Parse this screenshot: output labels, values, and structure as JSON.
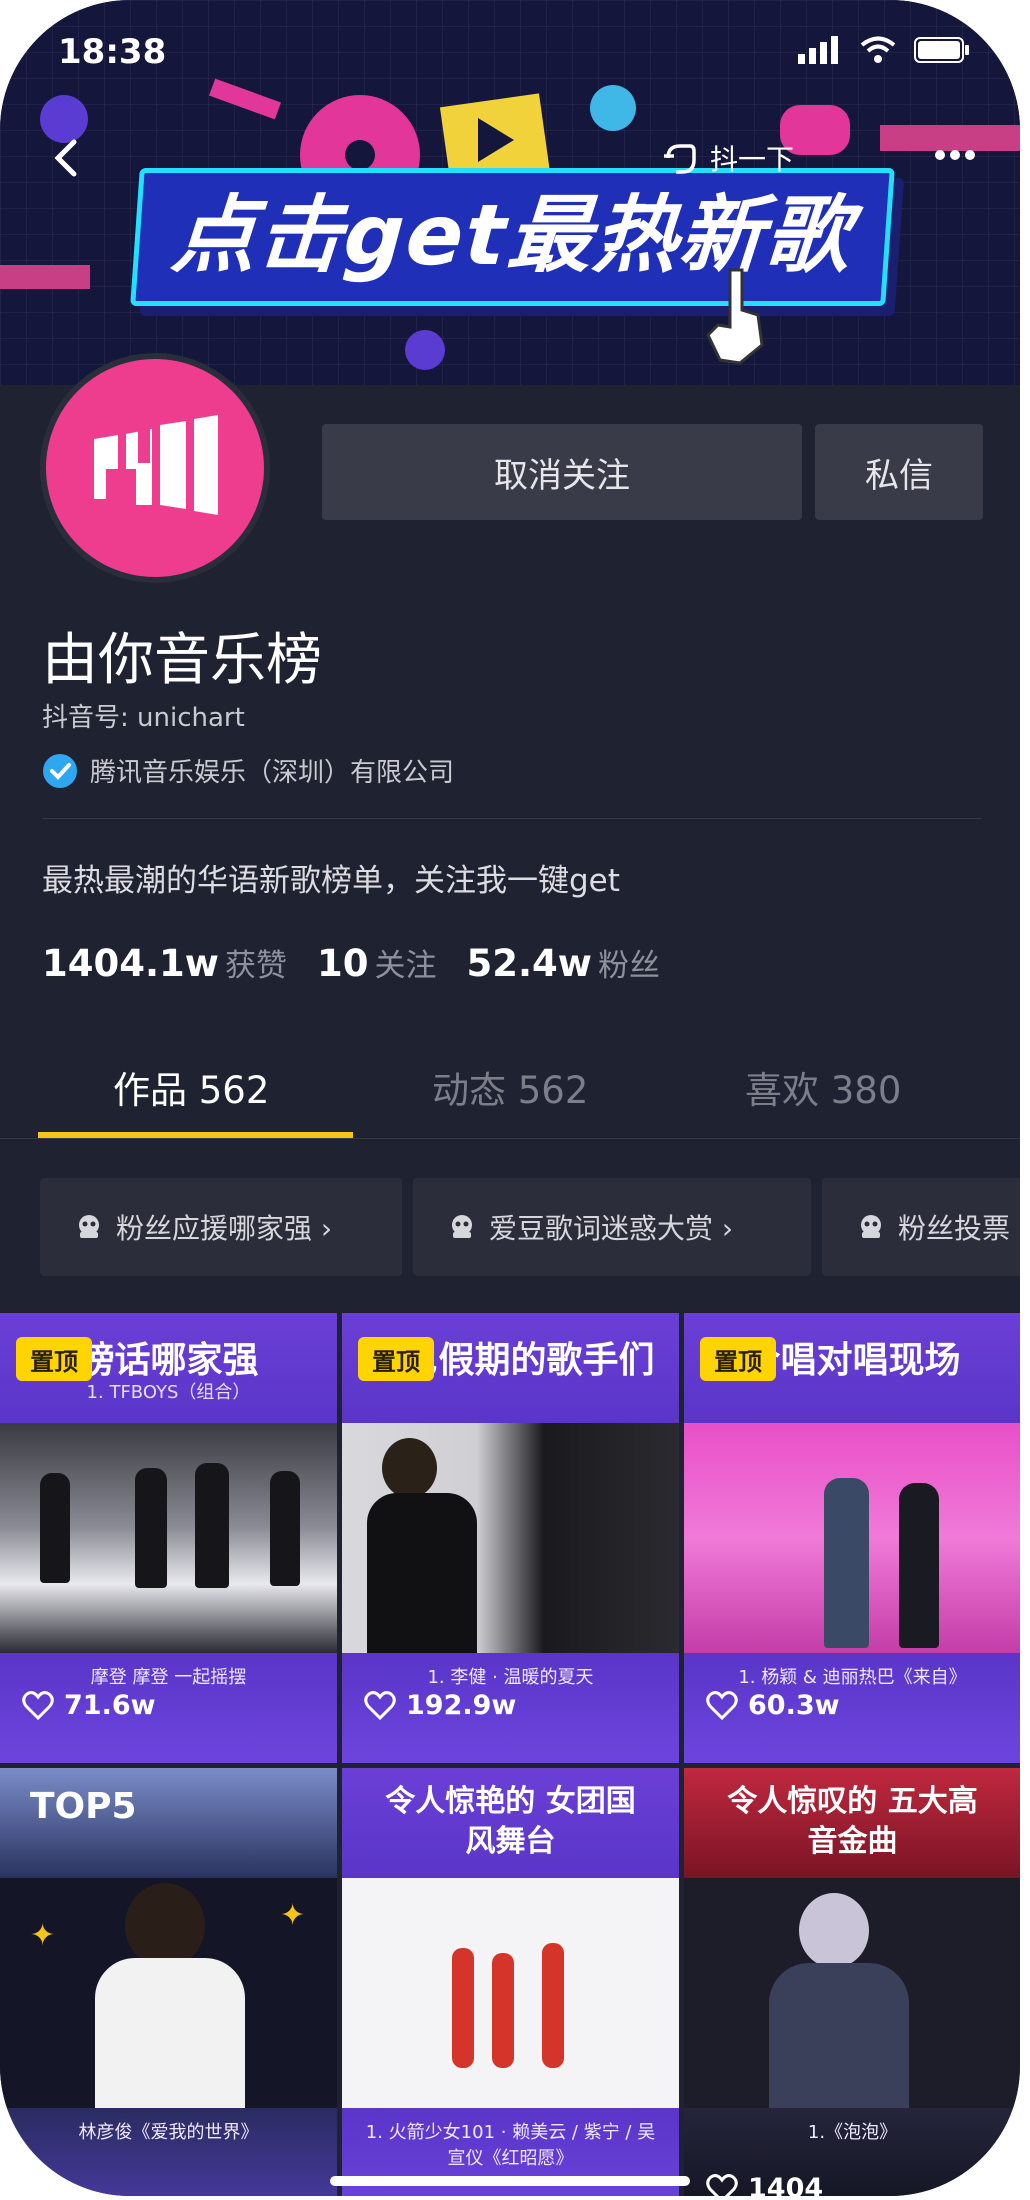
{
  "status_bar": {
    "time": "18:38"
  },
  "banner": {
    "text": "点击get最热新歌",
    "share_label": "抖一下"
  },
  "profile": {
    "unfollow_label": "取消关注",
    "message_label": "私信",
    "name": "由你音乐榜",
    "douyin_id": "抖音号: unichart",
    "verified_org": "腾讯音乐娱乐（深圳）有限公司",
    "bio": "最热最潮的华语新歌榜单，关注我一键get",
    "stats": [
      {
        "value": "1404.1w",
        "label": "获赞"
      },
      {
        "value": "10",
        "label": "关注"
      },
      {
        "value": "52.4w",
        "label": "粉丝"
      }
    ],
    "accent": "#ee3c8e"
  },
  "tabs": [
    {
      "label": "作品 562"
    },
    {
      "label": "动态 562"
    },
    {
      "label": "喜欢 380"
    }
  ],
  "playlists": [
    {
      "label": "粉丝应援哪家强 ›"
    },
    {
      "label": "爱豆歌词迷惑大赏 ›"
    },
    {
      "label": "粉丝投票"
    }
  ],
  "videos": [
    {
      "badge": "置顶",
      "title": "榜话哪家强",
      "subtitle": "1. TFBOYS（组合）",
      "caption": "摩登 摩登 一起摇摆",
      "likes": "71.6w"
    },
    {
      "badge": "置顶",
      "title": "尼尼假期的歌手们",
      "subtitle": "",
      "caption": "1. 李健 · 温暖的夏天",
      "likes": "192.9w"
    },
    {
      "badge": "置顶",
      "title": "合唱对唱现场",
      "subtitle": "",
      "caption": "1. 杨颖 & 迪丽热巴《来自》",
      "likes": "60.3w"
    },
    {
      "badge": "",
      "title": "TOP5",
      "subtitle": "",
      "caption": "林彦俊《爱我的世界》",
      "likes": ""
    },
    {
      "badge": "",
      "title": "令人惊艳的 女团国风舞台",
      "subtitle": "",
      "caption": "1. 火箭少女101 · 赖美云 / 紫宁 / 吴宣仪《红昭愿》",
      "likes": ""
    },
    {
      "badge": "",
      "title": "令人惊叹的 五大高音金曲",
      "subtitle": "",
      "caption": "1.《泡泡》",
      "likes": "1404"
    }
  ],
  "icons": {
    "back": "chevron-left-icon",
    "share": "pointer-hand-icon",
    "more": "more-dots-icon",
    "verified": "verified-badge-icon",
    "like": "heart-outline-icon",
    "playlist": "playlist-icon"
  }
}
